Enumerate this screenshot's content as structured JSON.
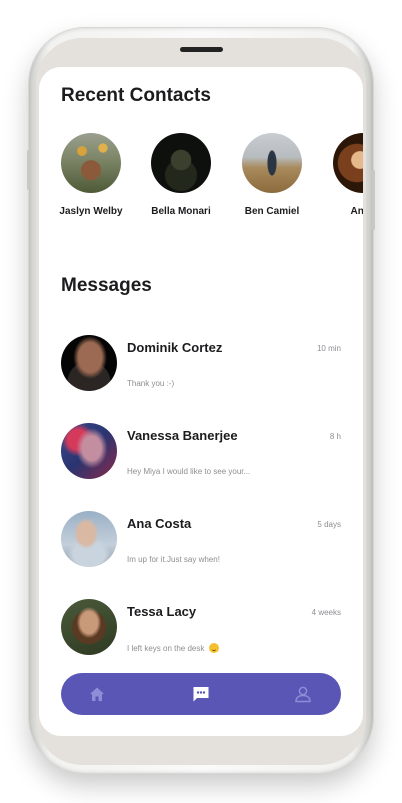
{
  "recent_contacts": {
    "title": "Recent Contacts",
    "items": [
      {
        "name": "Jaslyn Welby"
      },
      {
        "name": "Bella Monari"
      },
      {
        "name": "Ben Camiel"
      },
      {
        "name": "Ange"
      }
    ]
  },
  "messages": {
    "title": "Messages",
    "items": [
      {
        "name": "Dominik Cortez",
        "time": "10 min",
        "preview": "Thank you :-)"
      },
      {
        "name": "Vanessa Banerjee",
        "time": "8 h",
        "preview": "Hey Miya I would like to see your..."
      },
      {
        "name": "Ana Costa",
        "time": "5 days",
        "preview": "Im up for it.Just say when!"
      },
      {
        "name": "Tessa Lacy",
        "time": "4 weeks",
        "preview": "I left keys on the desk"
      }
    ]
  },
  "nav": {
    "items": [
      {
        "icon": "home-icon"
      },
      {
        "icon": "chat-icon"
      },
      {
        "icon": "user-icon"
      }
    ],
    "bar_color": "#5a56b5"
  }
}
